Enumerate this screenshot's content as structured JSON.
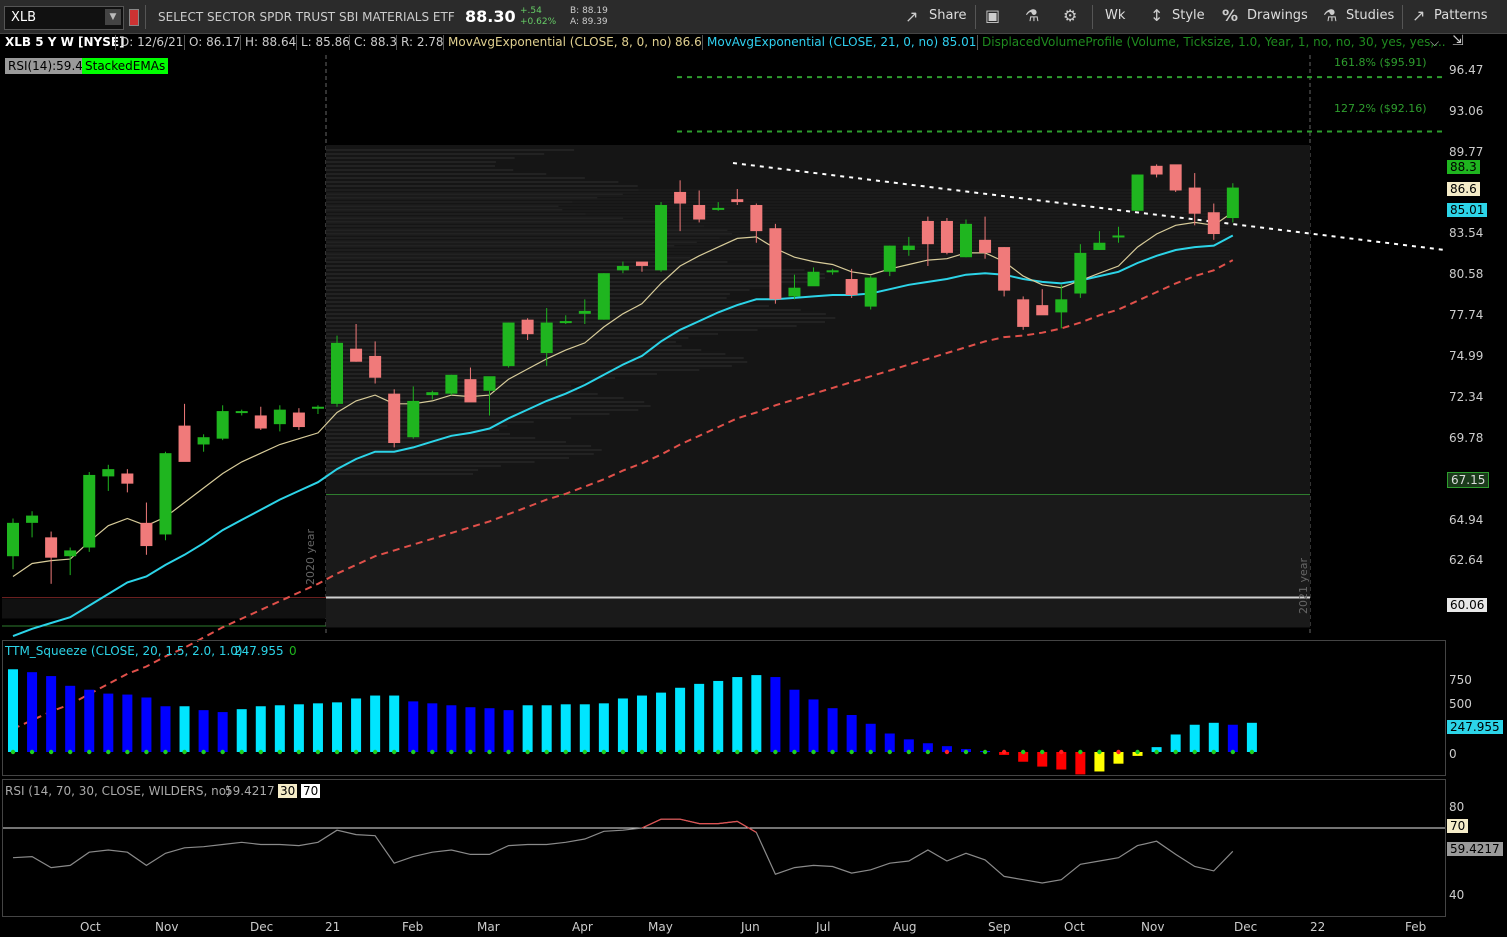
{
  "toolbar": {
    "symbol": "XLB",
    "description": "SELECT SECTOR SPDR TRUST SBI MATERIALS ETF",
    "last": "88.30",
    "change": "+.54",
    "change_pct": "+0.62%",
    "bid": "B: 88.19",
    "ask": "A: 89.39",
    "share": "Share",
    "period": "Wk",
    "style": "Style",
    "drawings": "Drawings",
    "studies": "Studies",
    "patterns": "Patterns"
  },
  "study_bar": {
    "title": "XLB 5 Y W [NYSE]",
    "date": "D: 12/6/21",
    "open": "O: 86.17",
    "high": "H: 88.64",
    "low": "L: 85.86",
    "close": "C: 88.3",
    "range": "R: 2.78",
    "ema8_label": "MovAvgExponential (CLOSE, 8, 0, no)",
    "ema8_value": "86.6",
    "ema21_label": "MovAvgExponential (CLOSE, 21, 0, no)",
    "ema21_value": "85.01",
    "dvp_label": "DisplacedVolumeProfile (Volume, Ticksize, 1.0, Year, 1, no, no, 30, yes, yes,..."
  },
  "badges": {
    "rsi": "RSI(14):59.4",
    "stacked": "StackedEMAs"
  },
  "fib": {
    "f1": "161.8%  ($95.91)",
    "f2": "127.2%  ($92.16)"
  },
  "year_labels": {
    "y2020": "2020 year",
    "y2021": "2021 year"
  },
  "price_axis": [
    "96.47",
    "93.06",
    "89.77",
    "83.54",
    "80.58",
    "77.74",
    "74.99",
    "72.34",
    "69.78",
    "64.94",
    "62.64"
  ],
  "price_tags": {
    "close": "88.3",
    "ema8": "86.6",
    "ema21": "85.01",
    "pvh": "67.15",
    "pvl": "60.06"
  },
  "squeeze": {
    "label": "TTM_Squeeze (CLOSE, 20, 1.5, 2.0, 1.0)",
    "value": "247.955",
    "value2": "0",
    "axis": [
      "750",
      "500",
      "0"
    ],
    "tag": "247.955"
  },
  "rsi": {
    "label": "RSI (14, 70, 30, CLOSE, WILDERS, no)",
    "value": "59.4217",
    "ob": "30",
    "os": "70",
    "axis": [
      "80",
      "40"
    ],
    "tag70": "70",
    "tag": "59.4217"
  },
  "months": [
    "Oct",
    "Nov",
    "Dec",
    "21",
    "Feb",
    "Mar",
    "Apr",
    "May",
    "Jun",
    "Jul",
    "Aug",
    "Sep",
    "Oct",
    "Nov",
    "Dec",
    "22",
    "Feb"
  ],
  "colors": {
    "up": "#1fb51f",
    "down": "#f07a7a",
    "ema8": "#d8cc9a",
    "ema21": "#2cd4e8",
    "ema50": "#e0504a",
    "fib": "#2e9e2e"
  },
  "chart_data": {
    "type": "candlestick",
    "ohlc": [
      [
        62.9,
        65.5,
        62.0,
        65.2
      ],
      [
        65.2,
        66.0,
        64.2,
        65.7
      ],
      [
        64.2,
        64.6,
        61.0,
        62.8
      ],
      [
        62.9,
        63.5,
        61.6,
        63.3
      ],
      [
        63.5,
        68.7,
        63.2,
        68.5
      ],
      [
        68.4,
        69.2,
        67.4,
        68.9
      ],
      [
        68.6,
        68.9,
        67.3,
        67.9
      ],
      [
        65.2,
        66.6,
        63.0,
        63.6
      ],
      [
        64.4,
        70.1,
        64.0,
        70.0
      ],
      [
        71.9,
        73.4,
        69.5,
        69.4
      ],
      [
        70.6,
        71.3,
        70.1,
        71.1
      ],
      [
        71.0,
        73.3,
        70.9,
        72.9
      ],
      [
        72.8,
        73.0,
        72.6,
        72.9
      ],
      [
        72.6,
        73.2,
        71.6,
        71.7
      ],
      [
        72.0,
        73.3,
        71.5,
        73.0
      ],
      [
        72.8,
        73.1,
        71.6,
        71.8
      ],
      [
        73.2,
        73.3,
        72.7,
        73.2
      ],
      [
        73.4,
        78.1,
        73.2,
        77.6
      ],
      [
        77.2,
        78.9,
        76.3,
        76.3
      ],
      [
        76.7,
        77.7,
        74.8,
        75.2
      ],
      [
        74.1,
        74.4,
        70.4,
        70.7
      ],
      [
        71.1,
        74.6,
        71.0,
        73.6
      ],
      [
        74.0,
        74.3,
        73.7,
        74.2
      ],
      [
        74.1,
        75.4,
        74.0,
        75.4
      ],
      [
        75.1,
        75.9,
        73.6,
        73.5
      ],
      [
        74.3,
        74.3,
        72.6,
        75.3
      ],
      [
        76.0,
        79.0,
        75.9,
        79.0
      ],
      [
        79.2,
        79.3,
        77.8,
        78.2
      ],
      [
        76.9,
        80.0,
        76.0,
        79.0
      ],
      [
        79.1,
        79.5,
        78.9,
        79.1
      ],
      [
        79.6,
        80.6,
        78.9,
        79.8
      ],
      [
        79.2,
        82.4,
        79.2,
        82.4
      ],
      [
        82.6,
        83.2,
        82.4,
        82.9
      ],
      [
        83.2,
        83.1,
        82.5,
        82.9
      ],
      [
        82.6,
        87.3,
        82.5,
        87.1
      ],
      [
        88.0,
        88.8,
        85.3,
        87.2
      ],
      [
        87.1,
        88.1,
        85.9,
        86.1
      ],
      [
        86.8,
        87.3,
        86.7,
        86.9
      ],
      [
        87.5,
        88.2,
        87.1,
        87.3
      ],
      [
        87.1,
        87.2,
        84.5,
        85.3
      ],
      [
        85.5,
        85.8,
        80.3,
        80.6
      ],
      [
        80.8,
        82.3,
        80.6,
        81.4
      ],
      [
        81.5,
        82.8,
        81.6,
        82.5
      ],
      [
        82.5,
        82.7,
        82.3,
        82.6
      ],
      [
        82.0,
        82.7,
        80.7,
        80.9
      ],
      [
        80.1,
        82.2,
        79.9,
        82.1
      ],
      [
        82.5,
        84.3,
        82.2,
        84.3
      ],
      [
        84.0,
        84.9,
        83.6,
        84.3
      ],
      [
        86.0,
        86.3,
        82.9,
        84.4
      ],
      [
        86.0,
        86.2,
        83.7,
        83.8
      ],
      [
        83.5,
        86.1,
        83.5,
        85.8
      ],
      [
        84.7,
        86.3,
        83.4,
        83.8
      ],
      [
        84.2,
        84.2,
        80.8,
        81.2
      ],
      [
        80.6,
        80.8,
        78.5,
        78.7
      ],
      [
        80.2,
        81.3,
        79.6,
        79.5
      ],
      [
        79.7,
        81.6,
        78.6,
        80.6
      ],
      [
        81.0,
        84.4,
        80.7,
        83.8
      ],
      [
        84.0,
        85.3,
        84.0,
        84.5
      ],
      [
        85.0,
        85.6,
        84.5,
        85.0
      ],
      [
        86.7,
        89.2,
        86.8,
        89.2
      ],
      [
        89.8,
        89.9,
        89.0,
        89.2
      ],
      [
        89.9,
        89.8,
        88.0,
        88.1
      ],
      [
        88.3,
        89.3,
        85.7,
        86.5
      ],
      [
        86.6,
        87.2,
        84.7,
        85.1
      ],
      [
        86.2,
        88.6,
        85.9,
        88.3
      ]
    ],
    "ema8": [
      61.5,
      62.4,
      62.6,
      62.7,
      63.9,
      65.0,
      65.5,
      65.0,
      65.6,
      66.6,
      67.6,
      68.6,
      69.4,
      70.0,
      70.6,
      71.0,
      71.4,
      72.8,
      73.6,
      74.0,
      73.4,
      73.4,
      73.6,
      74.0,
      73.9,
      74.0,
      75.1,
      75.8,
      76.5,
      77.1,
      77.6,
      78.7,
      79.6,
      80.3,
      81.7,
      82.9,
      83.6,
      84.2,
      84.8,
      84.9,
      84.1,
      83.5,
      83.2,
      83.0,
      82.5,
      82.3,
      82.7,
      83.0,
      83.3,
      83.4,
      83.8,
      83.8,
      83.2,
      82.2,
      81.6,
      81.4,
      81.9,
      82.4,
      82.9,
      84.2,
      85.1,
      85.7,
      85.9,
      85.7,
      86.6
    ],
    "ema21": [
      57.4,
      57.9,
      58.3,
      58.7,
      59.5,
      60.3,
      61.1,
      61.5,
      62.3,
      63.0,
      63.8,
      64.7,
      65.4,
      66.1,
      66.8,
      67.4,
      68.0,
      68.9,
      69.6,
      70.1,
      70.1,
      70.4,
      70.8,
      71.2,
      71.4,
      71.7,
      72.4,
      73.0,
      73.6,
      74.1,
      74.7,
      75.4,
      76.1,
      76.7,
      77.7,
      78.5,
      79.1,
      79.7,
      80.2,
      80.6,
      80.6,
      80.7,
      80.8,
      80.9,
      80.9,
      81.0,
      81.3,
      81.6,
      81.8,
      82.0,
      82.3,
      82.4,
      82.3,
      82.0,
      81.8,
      81.7,
      81.9,
      82.2,
      82.5,
      83.1,
      83.6,
      84.0,
      84.2,
      84.3,
      85.0
    ],
    "ema50": [
      51.0,
      51.6,
      52.2,
      52.7,
      53.4,
      54.1,
      54.8,
      55.3,
      56.0,
      56.6,
      57.3,
      58.0,
      58.6,
      59.2,
      59.8,
      60.4,
      61.0,
      61.7,
      62.3,
      62.9,
      63.3,
      63.7,
      64.1,
      64.5,
      64.9,
      65.3,
      65.8,
      66.3,
      66.8,
      67.2,
      67.7,
      68.2,
      68.8,
      69.3,
      69.9,
      70.6,
      71.2,
      71.8,
      72.4,
      72.8,
      73.3,
      73.7,
      74.1,
      74.5,
      74.9,
      75.3,
      75.7,
      76.1,
      76.5,
      76.9,
      77.3,
      77.7,
      78.0,
      78.1,
      78.3,
      78.6,
      79.0,
      79.5,
      79.9,
      80.5,
      81.1,
      81.7,
      82.2,
      82.6,
      83.3
    ],
    "squeeze_hist": [
      850,
      820,
      780,
      680,
      640,
      600,
      590,
      560,
      470,
      470,
      430,
      410,
      440,
      470,
      480,
      490,
      500,
      510,
      550,
      580,
      580,
      520,
      500,
      480,
      460,
      450,
      430,
      480,
      480,
      490,
      490,
      500,
      550,
      580,
      610,
      660,
      700,
      730,
      770,
      790,
      770,
      640,
      540,
      450,
      380,
      290,
      190,
      130,
      90,
      60,
      30,
      10,
      -30,
      -100,
      -150,
      -180,
      -230,
      -200,
      -120,
      -40,
      50,
      180,
      280,
      300,
      280,
      300
    ],
    "squeeze_dot_red": [
      49,
      50,
      51,
      52,
      53,
      54,
      55,
      56,
      57,
      58,
      59,
      60
    ],
    "rsi_values": [
      56.5,
      57.0,
      52.0,
      53.0,
      59.0,
      60.0,
      59.0,
      53.0,
      58.5,
      61.0,
      61.5,
      62.5,
      63.5,
      62.5,
      62.5,
      62.0,
      63.5,
      69.0,
      67.0,
      66.5,
      54.0,
      57.0,
      59.0,
      60.0,
      58.0,
      58.0,
      62.0,
      62.5,
      62.5,
      63.5,
      65.0,
      68.5,
      69.0,
      70.0,
      74.0,
      74.0,
      72.0,
      72.0,
      73.0,
      68.0,
      49.0,
      52.0,
      53.0,
      52.5,
      49.5,
      51.0,
      54.0,
      55.0,
      60.0,
      55.0,
      58.5,
      55.5,
      48.0,
      46.5,
      45.0,
      46.5,
      53.5,
      55.0,
      56.5,
      62.0,
      64.0,
      58.0,
      52.5,
      50.5,
      59.4
    ],
    "fib_levels": [
      95.91,
      92.16
    ],
    "year_levels": [
      67.15,
      60.06
    ]
  }
}
